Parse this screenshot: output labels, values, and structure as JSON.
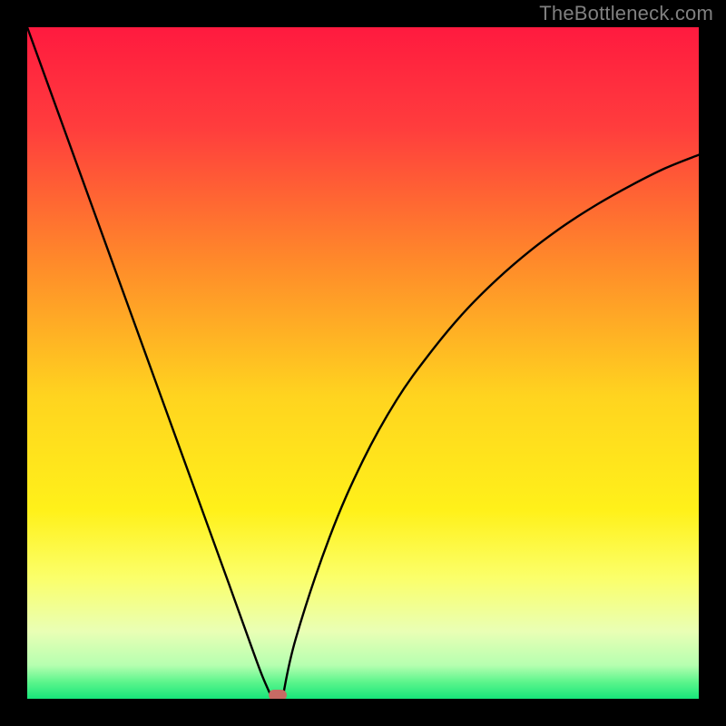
{
  "watermark": "TheBottleneck.com",
  "chart_data": {
    "type": "line",
    "title": "",
    "xlabel": "",
    "ylabel": "",
    "xlim": [
      0,
      1
    ],
    "ylim": [
      0,
      1
    ],
    "series": [
      {
        "name": "left-branch",
        "x": [
          0.0,
          0.05,
          0.1,
          0.15,
          0.2,
          0.25,
          0.3,
          0.333,
          0.35,
          0.365
        ],
        "values": [
          1.0,
          0.862,
          0.724,
          0.586,
          0.448,
          0.31,
          0.172,
          0.08,
          0.034,
          0.0
        ]
      },
      {
        "name": "right-branch",
        "x": [
          0.38,
          0.4,
          0.45,
          0.5,
          0.55,
          0.6,
          0.65,
          0.7,
          0.75,
          0.8,
          0.85,
          0.9,
          0.95,
          1.0
        ],
        "values": [
          0.0,
          0.09,
          0.24,
          0.355,
          0.445,
          0.515,
          0.575,
          0.625,
          0.668,
          0.705,
          0.737,
          0.765,
          0.79,
          0.81
        ]
      }
    ],
    "marker": {
      "x": 0.373,
      "y": 0.0
    },
    "gradient_stops": [
      {
        "offset": 0.0,
        "color": "#ff1a3f"
      },
      {
        "offset": 0.15,
        "color": "#ff3d3d"
      },
      {
        "offset": 0.35,
        "color": "#ff8a2a"
      },
      {
        "offset": 0.55,
        "color": "#ffd41f"
      },
      {
        "offset": 0.72,
        "color": "#fff11a"
      },
      {
        "offset": 0.82,
        "color": "#fbff6a"
      },
      {
        "offset": 0.9,
        "color": "#e9ffb5"
      },
      {
        "offset": 0.95,
        "color": "#b6ffb0"
      },
      {
        "offset": 0.975,
        "color": "#5cf58c"
      },
      {
        "offset": 1.0,
        "color": "#17e67a"
      }
    ]
  }
}
